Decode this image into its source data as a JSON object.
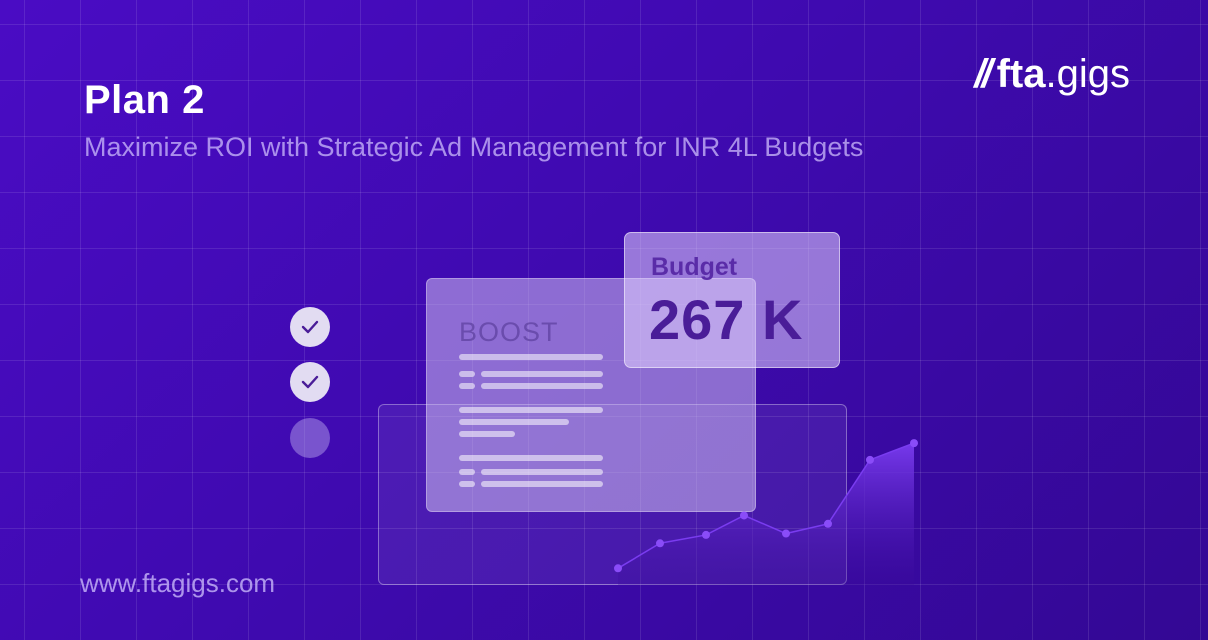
{
  "header": {
    "title": "Plan 2",
    "subtitle": "Maximize ROI with Strategic Ad Management for INR 4L Budgets"
  },
  "logo": {
    "slash": "//",
    "brand": "fta",
    "suffix": ".gigs"
  },
  "footer": {
    "url": "www.ftagigs.com"
  },
  "checklist": [
    {
      "checked": true
    },
    {
      "checked": true
    },
    {
      "checked": false
    }
  ],
  "boost_card": {
    "title": "BOOST"
  },
  "budget_card": {
    "label": "Budget",
    "value": "267 K"
  },
  "chart_data": {
    "type": "area",
    "values": [
      12,
      30,
      36,
      50,
      37,
      44,
      90,
      102
    ],
    "color": "#7a3cf0"
  },
  "colors": {
    "background": "#3f0ab0",
    "accent": "#7a3cf0"
  }
}
